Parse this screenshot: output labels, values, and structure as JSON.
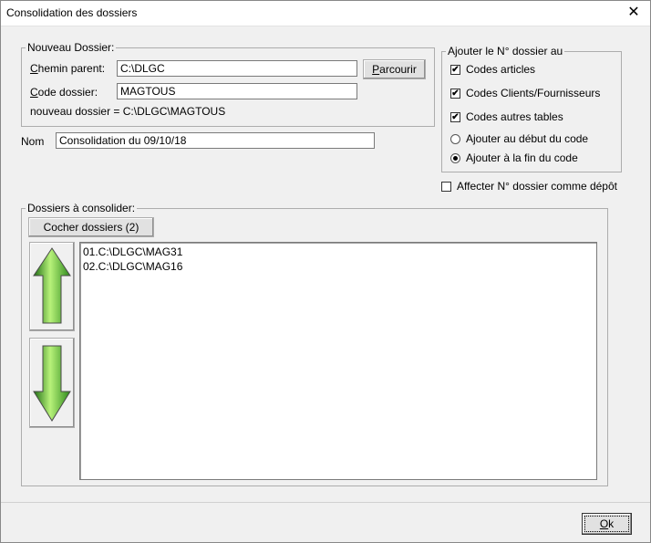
{
  "window": {
    "title": "Consolidation des dossiers",
    "close_glyph": "✕"
  },
  "nouveau": {
    "legend": "Nouveau Dossier:",
    "chemin_label_u": "C",
    "chemin_label_rest": "hemin parent:",
    "chemin_value": "C:\\DLGC",
    "parcourir_u": "P",
    "parcourir_rest": "arcourir",
    "code_label_u": "C",
    "code_label_rest": "ode dossier:",
    "code_value": "MAGTOUS",
    "nouveau_text": "nouveau dossier = C:\\DLGC\\MAGTOUS"
  },
  "nom": {
    "label": "Nom",
    "value": "Consolidation du 09/10/18"
  },
  "ajouter": {
    "legend": "Ajouter le N° dossier au",
    "options": [
      {
        "label": "Codes articles",
        "type": "checkbox",
        "checked": true
      },
      {
        "label": "Codes Clients/Fournisseurs",
        "type": "checkbox",
        "checked": true
      },
      {
        "label": "Codes autres tables",
        "type": "checkbox",
        "checked": true
      },
      {
        "label": "Ajouter au début du code",
        "type": "radio",
        "checked": false
      },
      {
        "label": "Ajouter à la fin du code",
        "type": "radio",
        "checked": true
      }
    ]
  },
  "depot": {
    "label": "Affecter N° dossier comme dépôt",
    "checked": false
  },
  "dossiers": {
    "legend": "Dossiers à consolider:",
    "cocher_label": "Cocher dossiers (2)",
    "items": [
      "01.C:\\DLGC\\MAG31",
      "02.C:\\DLGC\\MAG16"
    ]
  },
  "icons": {
    "up": "arrow-up-icon",
    "down": "arrow-down-icon"
  },
  "colors": {
    "arrow_light": "#b8f27a",
    "arrow_dark": "#2e8a1c"
  },
  "ok": {
    "label_u": "O",
    "label_rest": "k"
  }
}
